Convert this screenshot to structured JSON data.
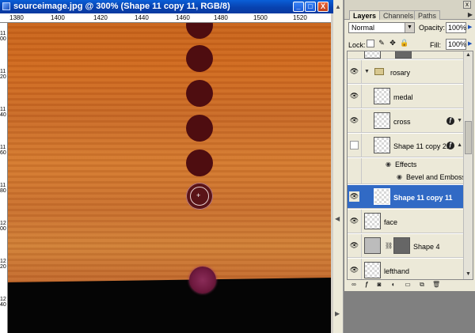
{
  "document": {
    "title": "sourceimage.jpg @ 300% (Shape 11 copy 11, RGB/8)",
    "min_label": "_",
    "max_label": "□",
    "close_label": "X",
    "ruler_top": [
      "1380",
      "1400",
      "1420",
      "1440",
      "1460",
      "1480",
      "1500",
      "1520"
    ],
    "ruler_left": [
      "1100",
      "1120",
      "1140",
      "1160",
      "1180",
      "1200",
      "1220",
      "1240"
    ],
    "cursor_glyph": "+"
  },
  "panel": {
    "tabs": [
      {
        "label": "Layers",
        "active": true
      },
      {
        "label": "Channels",
        "active": false
      },
      {
        "label": "Paths",
        "active": false
      }
    ],
    "close_label": "x",
    "menu_arrow": "▶",
    "blend_mode": "Normal",
    "opacity_label": "Opacity:",
    "opacity_value": "100%",
    "lock_label": "Lock:",
    "fill_label": "Fill:",
    "fill_value": "100%",
    "layers": [
      {
        "name": "rosary",
        "kind": "group"
      },
      {
        "name": "medal",
        "kind": "layer"
      },
      {
        "name": "cross",
        "kind": "layer",
        "fx": true
      },
      {
        "name": "Shape 11 copy 21",
        "kind": "layer",
        "fx": true,
        "hidden": true
      },
      {
        "name": "Effects",
        "kind": "effect"
      },
      {
        "name": "Bevel and Emboss",
        "kind": "effect"
      },
      {
        "name": "Shape 11 copy 11",
        "kind": "layer",
        "selected": true
      },
      {
        "name": "face",
        "kind": "layer"
      },
      {
        "name": "Shape 4",
        "kind": "shape"
      },
      {
        "name": "lefthand",
        "kind": "layer"
      }
    ],
    "fx_glyph": "ƒ",
    "eye_glyph": "👁"
  },
  "colors": {
    "titlebar": "#0842b0",
    "selection": "#316ac5",
    "bead": "#4e0d10",
    "wood": "#c8631c"
  }
}
